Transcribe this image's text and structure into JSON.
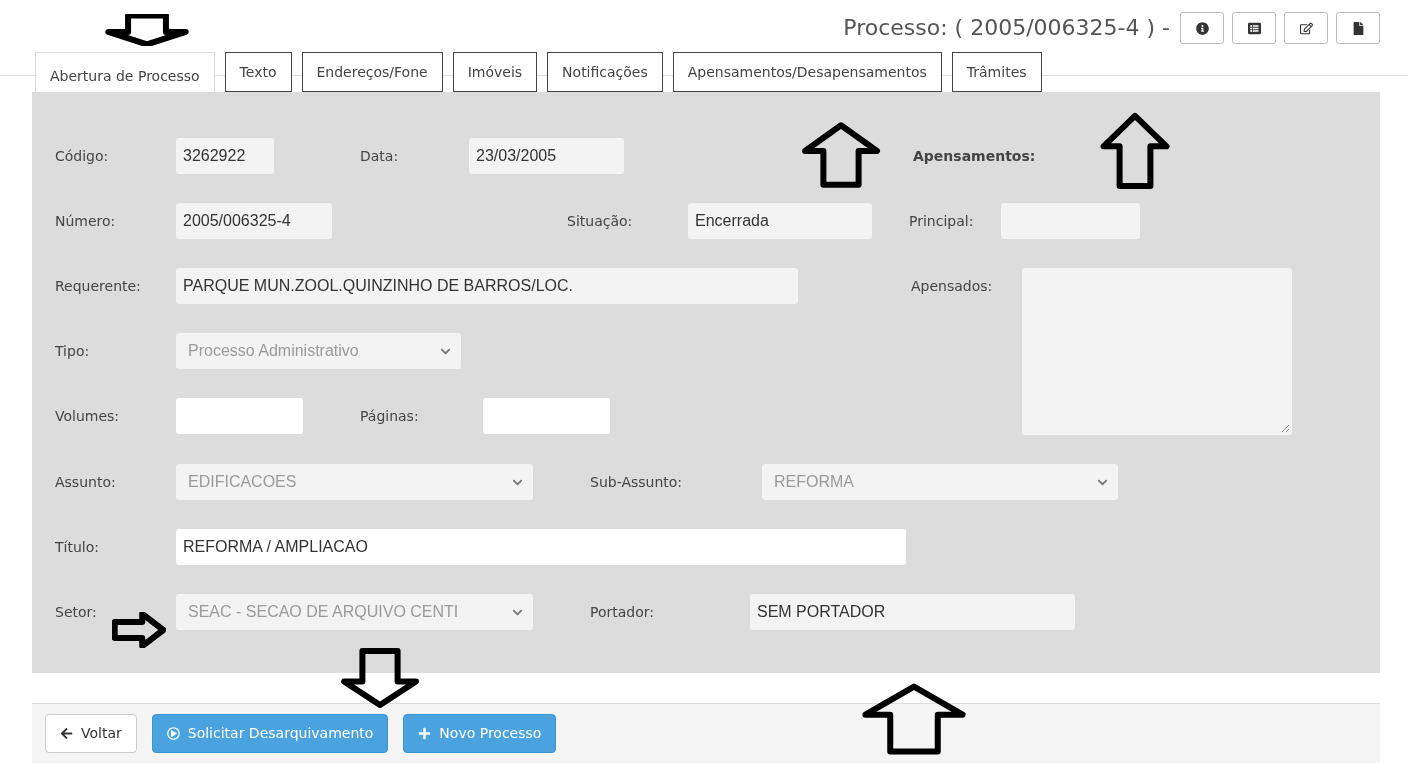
{
  "header": {
    "title": "Processo: ( 2005/006325-4 ) -",
    "toolbar_buttons": [
      {
        "kind": "info"
      },
      {
        "kind": "list"
      },
      {
        "kind": "edit"
      },
      {
        "kind": "file"
      }
    ]
  },
  "tabs": [
    {
      "label": "Abertura de Processo",
      "selected": true
    },
    {
      "label": "Texto",
      "selected": false
    },
    {
      "label": "Endereços/Fone",
      "selected": false
    },
    {
      "label": "Imóveis",
      "selected": false
    },
    {
      "label": "Notificações",
      "selected": false
    },
    {
      "label": "Apensamentos/Desapensamentos",
      "selected": false
    },
    {
      "label": "Trâmites",
      "selected": false
    }
  ],
  "form": {
    "codigo": {
      "label": "Código:",
      "kind": "input",
      "value": "3262922",
      "disabled": true
    },
    "data": {
      "label": "Data:",
      "kind": "input",
      "value": "23/03/2005",
      "disabled": true
    },
    "apensamentos_heading": "Apensamentos:",
    "numero": {
      "label": "Número:",
      "kind": "input",
      "value": "2005/006325-4",
      "disabled": true
    },
    "situacao": {
      "label": "Situação:",
      "kind": "input",
      "value": "Encerrada",
      "disabled": true
    },
    "principal": {
      "label": "Principal:",
      "kind": "input",
      "disabled": true
    },
    "requerente": {
      "label": "Requerente:",
      "kind": "input",
      "value": "PARQUE MUN.ZOOL.QUINZINHO DE BARROS/LOC.",
      "disabled": true
    },
    "apensados": {
      "label": "Apensados:",
      "kind": "textarea",
      "disabled": true
    },
    "tipo": {
      "label": "Tipo:",
      "kind": "select",
      "value": "Processo Administrativo",
      "disabled": true
    },
    "volumes": {
      "label": "Volumes:",
      "kind": "input",
      "disabled": false
    },
    "paginas": {
      "label": "Páginas:",
      "kind": "input",
      "disabled": false
    },
    "assunto": {
      "label": "Assunto:",
      "kind": "select",
      "value": "EDIFICACOES",
      "disabled": true
    },
    "sub_assunto": {
      "label": "Sub-Assunto:",
      "kind": "select",
      "value": "REFORMA",
      "disabled": true
    },
    "titulo": {
      "label": "Título:",
      "kind": "input",
      "value": "REFORMA / AMPLIACAO",
      "disabled": false
    },
    "setor": {
      "label": "Setor:",
      "kind": "select",
      "value": "SEAC - SECAO DE ARQUIVO CENTI",
      "disabled": true
    },
    "portador": {
      "label": "Portador:",
      "kind": "input",
      "value": "SEM PORTADOR",
      "disabled": true
    }
  },
  "buttons": [
    {
      "label": "Voltar",
      "kind": "back"
    },
    {
      "label": "Solicitar Desarquivamento",
      "kind": "request"
    },
    {
      "label": "Novo Processo",
      "kind": "create"
    }
  ],
  "annotations": [
    {
      "kind": "down"
    },
    {
      "kind": "up"
    },
    {
      "kind": "up"
    },
    {
      "kind": "right"
    },
    {
      "kind": "down"
    },
    {
      "kind": "up"
    }
  ]
}
